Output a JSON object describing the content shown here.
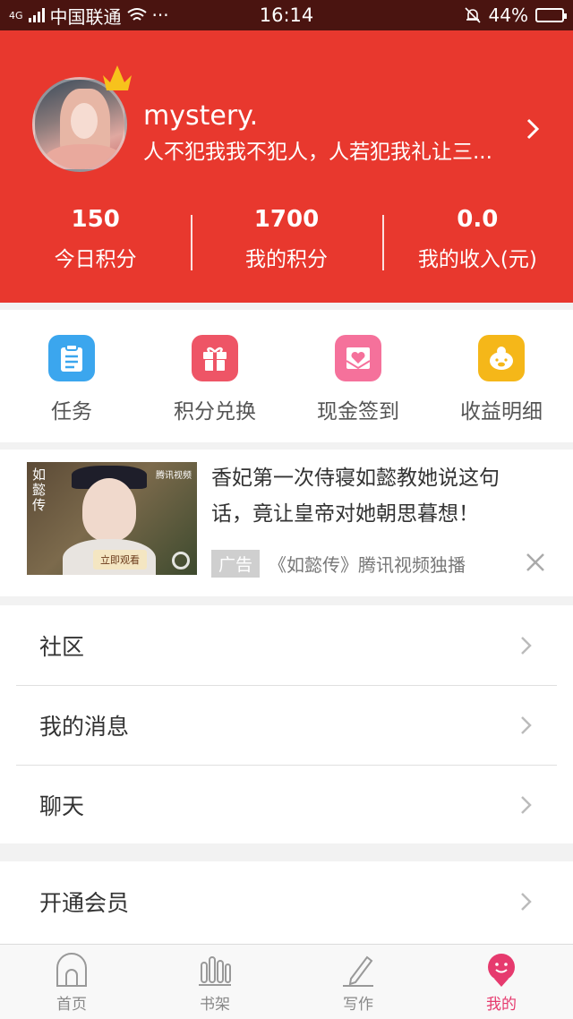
{
  "status_bar": {
    "network": "4G",
    "carrier": "中国联通",
    "more": "···",
    "time": "16:14",
    "battery": "44%",
    "battery_level": 0.44
  },
  "profile": {
    "username": "mystery.",
    "motto": "人不犯我我不犯人，人若犯我礼让三..."
  },
  "stats": [
    {
      "value": "150",
      "label": "今日积分"
    },
    {
      "value": "1700",
      "label": "我的积分"
    },
    {
      "value": "0.0",
      "label": "我的收入(元)"
    }
  ],
  "actions": [
    {
      "label": "任务",
      "icon": "clipboard-icon",
      "color": "#3ba6ee"
    },
    {
      "label": "积分兑换",
      "icon": "gift-icon",
      "color": "#ee5566"
    },
    {
      "label": "现金签到",
      "icon": "heart-envelope-icon",
      "color": "#f5719b"
    },
    {
      "label": "收益明细",
      "icon": "piggy-bank-icon",
      "color": "#f5b719"
    }
  ],
  "ad": {
    "title": "香妃第一次侍寝如懿教她说这句话，竟让皇帝对她朝思暮想！",
    "tag": "广告",
    "source": "《如懿传》腾讯视频独播",
    "image_title": "如懿传",
    "image_button": "立即观看",
    "image_brand": "腾讯视频"
  },
  "menu_group_1": [
    {
      "label": "社区"
    },
    {
      "label": "我的消息"
    },
    {
      "label": "聊天"
    }
  ],
  "menu_group_2": [
    {
      "label": "开通会员"
    }
  ],
  "tabs": [
    {
      "label": "首页",
      "icon": "home-icon"
    },
    {
      "label": "书架",
      "icon": "bookshelf-icon"
    },
    {
      "label": "写作",
      "icon": "pen-icon"
    },
    {
      "label": "我的",
      "icon": "profile-icon",
      "active": true
    }
  ],
  "colors": {
    "brand_red": "#e8382e",
    "active_pink": "#e63a6e"
  }
}
